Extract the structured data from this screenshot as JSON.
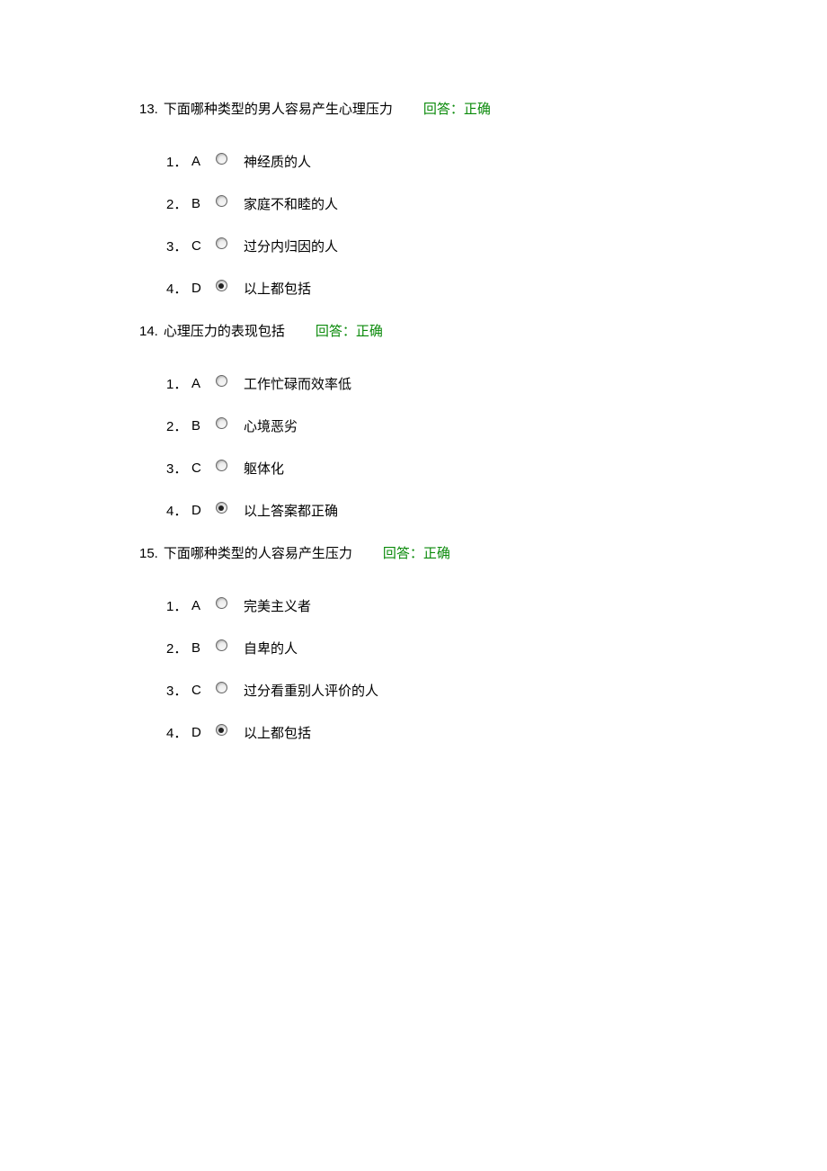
{
  "feedback_prefix": "回答：",
  "feedback_value": "正确",
  "questions": [
    {
      "number": "13.",
      "text": "下面哪种类型的男人容易产生心理压力",
      "options": [
        {
          "index": "1．",
          "letter": "A",
          "label": "神经质的人",
          "selected": false
        },
        {
          "index": "2．",
          "letter": "B",
          "label": "家庭不和睦的人",
          "selected": false
        },
        {
          "index": "3．",
          "letter": "C",
          "label": "过分内归因的人",
          "selected": false
        },
        {
          "index": "4．",
          "letter": "D",
          "label": "以上都包括",
          "selected": true
        }
      ]
    },
    {
      "number": "14.",
      "text": "心理压力的表现包括",
      "options": [
        {
          "index": "1．",
          "letter": "A",
          "label": "工作忙碌而效率低",
          "selected": false
        },
        {
          "index": "2．",
          "letter": "B",
          "label": "心境恶劣",
          "selected": false
        },
        {
          "index": "3．",
          "letter": "C",
          "label": "躯体化",
          "selected": false
        },
        {
          "index": "4．",
          "letter": "D",
          "label": "以上答案都正确",
          "selected": true
        }
      ]
    },
    {
      "number": "15.",
      "text": "下面哪种类型的人容易产生压力",
      "options": [
        {
          "index": "1．",
          "letter": "A",
          "label": "完美主义者",
          "selected": false
        },
        {
          "index": "2．",
          "letter": "B",
          "label": "自卑的人",
          "selected": false
        },
        {
          "index": "3．",
          "letter": "C",
          "label": "过分看重别人评价的人",
          "selected": false
        },
        {
          "index": "4．",
          "letter": "D",
          "label": "以上都包括",
          "selected": true
        }
      ]
    }
  ]
}
